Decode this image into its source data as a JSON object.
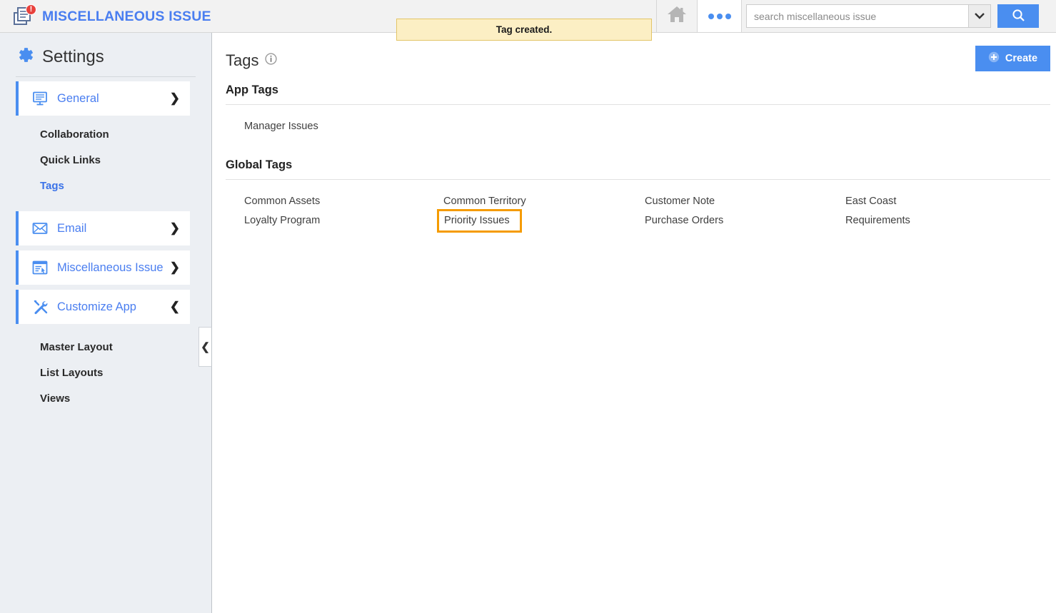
{
  "topbar": {
    "app_title": "MISCELLANEOUS ISSUE",
    "app_icon": "document-list-icon",
    "badge_count": "!",
    "home_icon": "home-icon",
    "more_icon": "more-options-icon",
    "search_placeholder": "search miscellaneous issue",
    "search_value": "",
    "search_dropdown_icon": "chevron-down-icon",
    "search_button_icon": "search-icon"
  },
  "notification": {
    "message": "Tag created."
  },
  "sidebar": {
    "title": "Settings",
    "title_icon": "gear-icon",
    "collapse_icon": "chevron-left-icon",
    "groups": [
      {
        "label": "General",
        "icon": "monitor-icon",
        "chevron": "chevron-right-icon",
        "items": [
          {
            "label": "Collaboration",
            "active": false
          },
          {
            "label": "Quick Links",
            "active": false
          },
          {
            "label": "Tags",
            "active": true
          }
        ]
      },
      {
        "label": "Email",
        "icon": "envelope-icon",
        "chevron": "chevron-right-icon",
        "items": []
      },
      {
        "label": "Miscellaneous Issue",
        "icon": "form-window-icon",
        "chevron": "chevron-right-icon",
        "items": []
      },
      {
        "label": "Customize App",
        "icon": "tools-icon",
        "chevron": "chevron-down-icon",
        "items": [
          {
            "label": "Master Layout",
            "active": false
          },
          {
            "label": "List Layouts",
            "active": false
          },
          {
            "label": "Views",
            "active": false
          }
        ]
      }
    ]
  },
  "main": {
    "page_title": "Tags",
    "info_icon": "info-icon",
    "create_label": "Create",
    "create_icon": "plus-circle-icon",
    "app_tags": {
      "heading": "App Tags",
      "tags": [
        "Manager Issues"
      ]
    },
    "global_tags": {
      "heading": "Global Tags",
      "tags": [
        "Common Assets",
        "Common Territory",
        "Customer Note",
        "East Coast",
        "Loyalty Program",
        "Priority Issues",
        "Purchase Orders",
        "Requirements"
      ],
      "highlighted": "Priority Issues"
    }
  },
  "colors": {
    "accent_blue": "#4a8ef0",
    "link_blue": "#4a7ef0",
    "sidebar_bg": "#eceff3",
    "notice_bg": "#fcefc4",
    "notice_border": "#e3c567",
    "highlight_orange": "#f59b00",
    "badge_red": "#e8413c"
  }
}
